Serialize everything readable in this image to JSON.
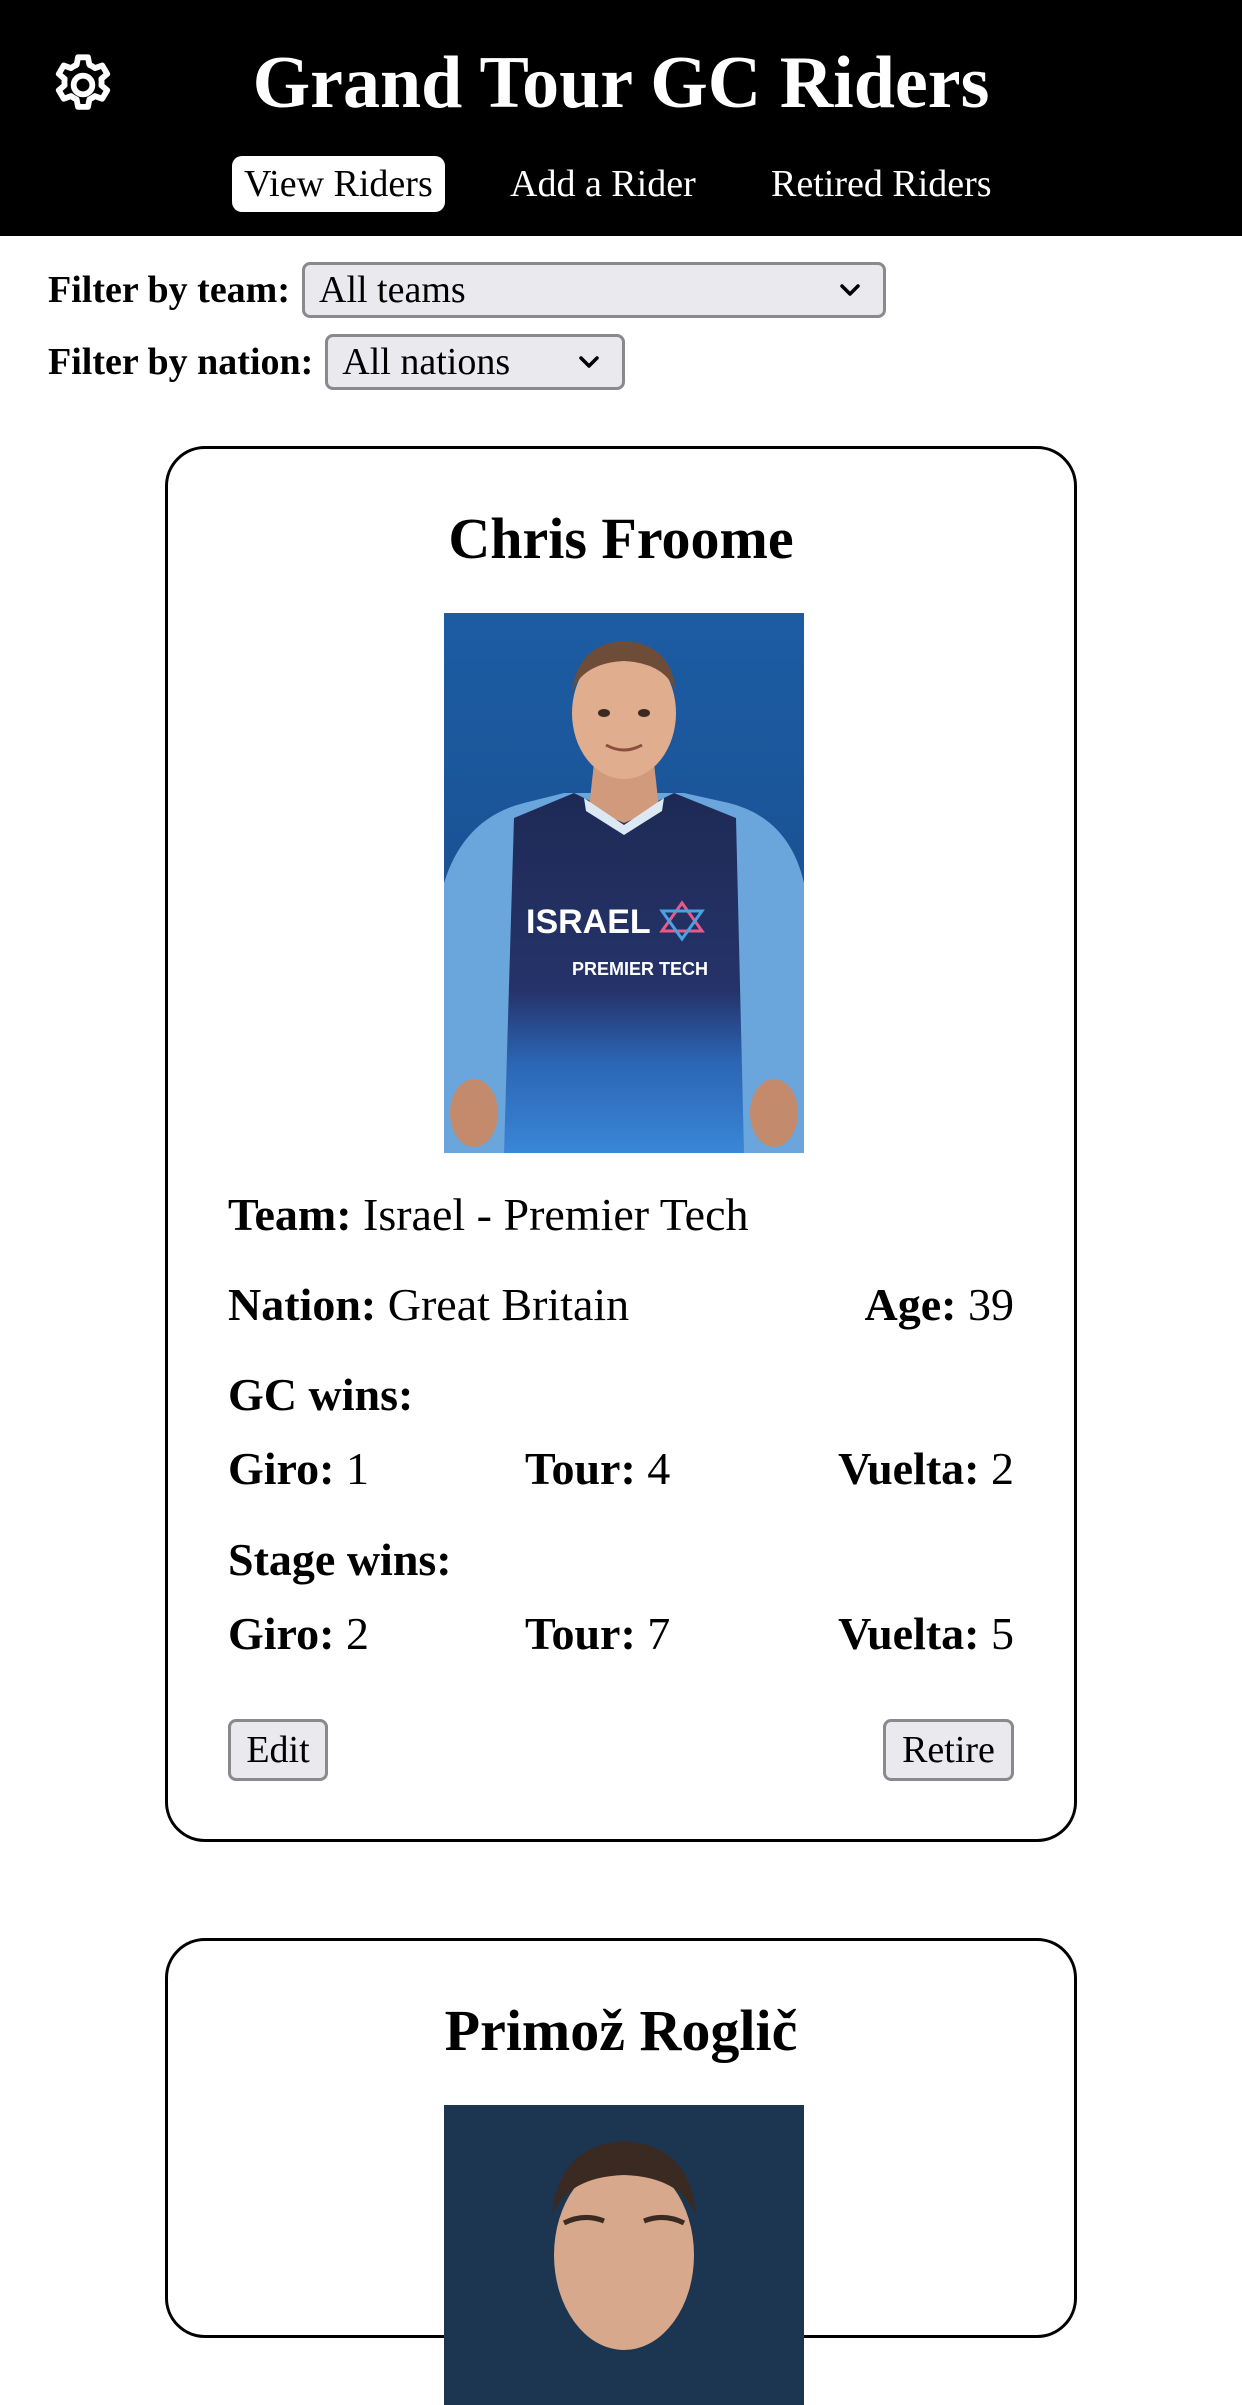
{
  "header": {
    "title": "Grand Tour GC Riders",
    "settings_icon": "gear-icon",
    "nav": [
      {
        "label": "View Riders",
        "active": true
      },
      {
        "label": "Add a Rider",
        "active": false
      },
      {
        "label": "Retired Riders",
        "active": false
      }
    ]
  },
  "filters": {
    "team": {
      "label": "Filter by team:",
      "value": "All teams"
    },
    "nation": {
      "label": "Filter by nation:",
      "value": "All nations"
    }
  },
  "riders": [
    {
      "name": "Chris Froome",
      "team_label": "Team:",
      "team": "Israel - Premier Tech",
      "nation_label": "Nation:",
      "nation": "Great Britain",
      "age_label": "Age:",
      "age": "39",
      "gc_wins_label": "GC wins:",
      "gc_wins": {
        "giro_label": "Giro:",
        "giro": "1",
        "tour_label": "Tour:",
        "tour": "4",
        "vuelta_label": "Vuelta:",
        "vuelta": "2"
      },
      "stage_wins_label": "Stage wins:",
      "stage_wins": {
        "giro_label": "Giro:",
        "giro": "2",
        "tour_label": "Tour:",
        "tour": "7",
        "vuelta_label": "Vuelta:",
        "vuelta": "5"
      },
      "edit_label": "Edit",
      "retire_label": "Retire",
      "jersey_text": "ISRAEL",
      "jersey_sponsor": "PREMIER TECH"
    },
    {
      "name": "Primož Roglič"
    }
  ],
  "colors": {
    "header_bg": "#000000",
    "jersey_blue": "#2f6db8",
    "photo_bg": "#1f5a9e",
    "control_bg": "#e9e9ee"
  }
}
